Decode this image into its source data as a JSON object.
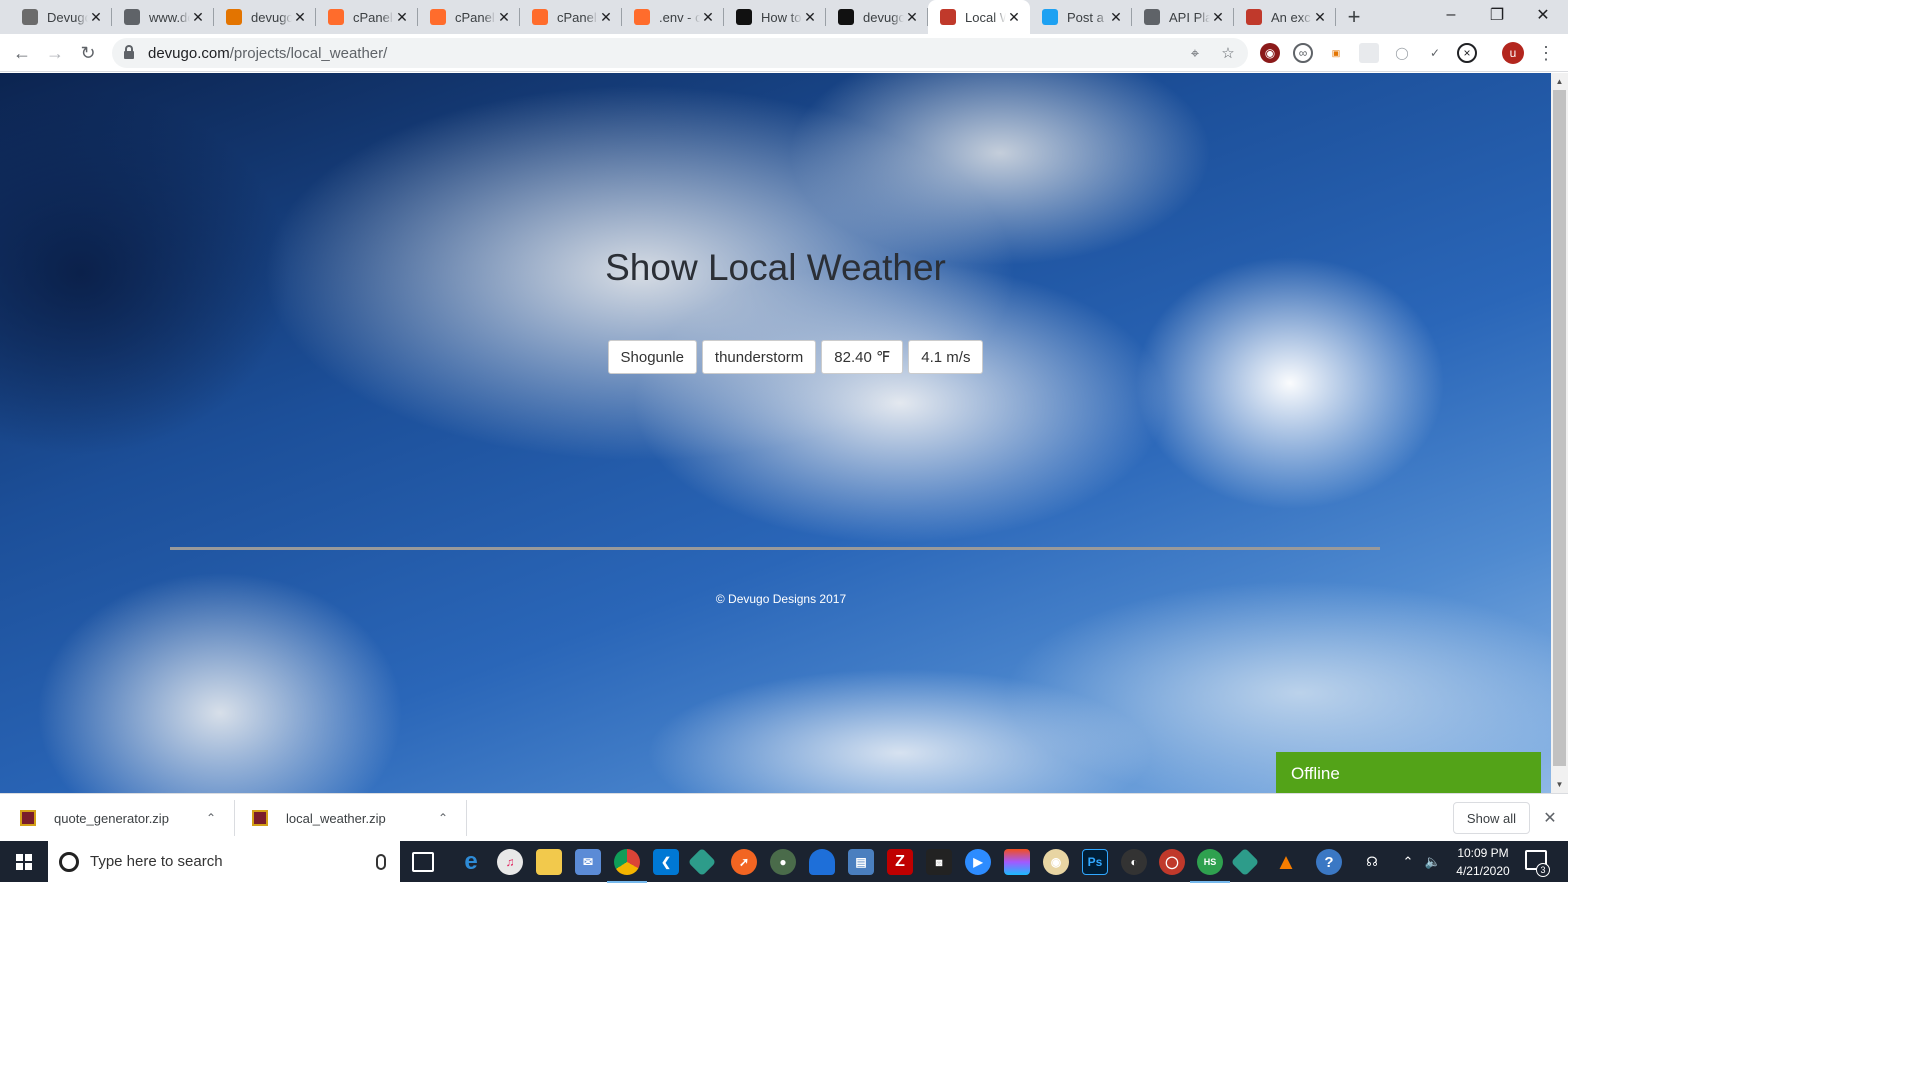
{
  "browser": {
    "tabs": [
      {
        "title": "Devugo",
        "favicon_color": "#6b6b6b",
        "favicon_glyph": "person-avatar-icon"
      },
      {
        "title": "www.devugo",
        "favicon_color": "#5f6368",
        "favicon_glyph": "globe-icon"
      },
      {
        "title": "devugo",
        "favicon_color": "#e37400",
        "favicon_glyph": "chart-icon"
      },
      {
        "title": "cPanel",
        "favicon_color": "#ff6c2c",
        "favicon_glyph": "cpanel-icon"
      },
      {
        "title": "cPanel",
        "favicon_color": "#ff6c2c",
        "favicon_glyph": "cpanel-icon"
      },
      {
        "title": "cPanel",
        "favicon_color": "#ff6c2c",
        "favicon_glyph": "cpanel-icon"
      },
      {
        "title": ".env - c",
        "favicon_color": "#ff6c2c",
        "favicon_glyph": "cpanel-icon"
      },
      {
        "title": "How to",
        "favicon_color": "#111111",
        "favicon_glyph": "symfony-icon"
      },
      {
        "title": "devugo",
        "favicon_color": "#111111",
        "favicon_glyph": "github-icon"
      },
      {
        "title": "Local W",
        "favicon_color": "#c0392b",
        "favicon_glyph": "weather-app-icon"
      },
      {
        "title": "Post a",
        "favicon_color": "#1da1f2",
        "favicon_glyph": "twitter-icon"
      },
      {
        "title": "API Pla",
        "favicon_color": "#5f6368",
        "favicon_glyph": "globe-icon"
      },
      {
        "title": "An exc",
        "favicon_color": "#c0392b",
        "favicon_glyph": "mascot-icon"
      }
    ],
    "active_tab_index": 9,
    "url_host": "devugo.com",
    "url_path": "/projects/local_weather/",
    "profile_initial": "u"
  },
  "page": {
    "title": "Show Local Weather",
    "location": "Shogunle",
    "condition": "thunderstorm",
    "temperature": "82.40 ℉",
    "wind": "4.1 m/s",
    "footer": "© Devugo Designs 2017",
    "chat_widget": "Offline",
    "chat_widget_color": "#53a318"
  },
  "downloads": {
    "items": [
      {
        "filename": "quote_generator.zip"
      },
      {
        "filename": "local_weather.zip"
      }
    ],
    "show_all": "Show all"
  },
  "taskbar": {
    "search_placeholder": "Type here to search",
    "time": "10:09 PM",
    "date": "4/21/2020",
    "notification_count": "3"
  }
}
